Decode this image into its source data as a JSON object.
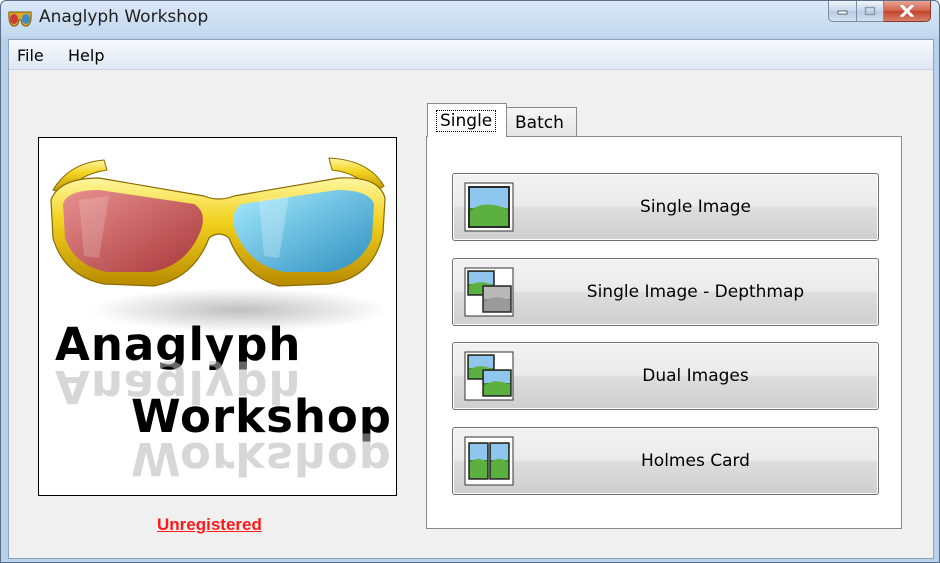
{
  "window": {
    "title": "Anaglyph Workshop",
    "icon": "3d-glasses-icon"
  },
  "menu": {
    "items": [
      "File",
      "Help"
    ]
  },
  "logo": {
    "line1": "Anaglyph",
    "line2": "Workshop",
    "image": "3d-glasses-logo"
  },
  "status": {
    "registration": "Unregistered",
    "color": "#ff1a1a"
  },
  "tabs": [
    {
      "label": "Single",
      "selected": true
    },
    {
      "label": "Batch",
      "selected": false
    }
  ],
  "buttons": [
    {
      "label": "Single Image",
      "icon": "single-image-icon"
    },
    {
      "label": "Single Image - Depthmap",
      "icon": "depthmap-icon"
    },
    {
      "label": "Dual Images",
      "icon": "dual-images-icon"
    },
    {
      "label": "Holmes Card",
      "icon": "holmes-card-icon"
    }
  ]
}
